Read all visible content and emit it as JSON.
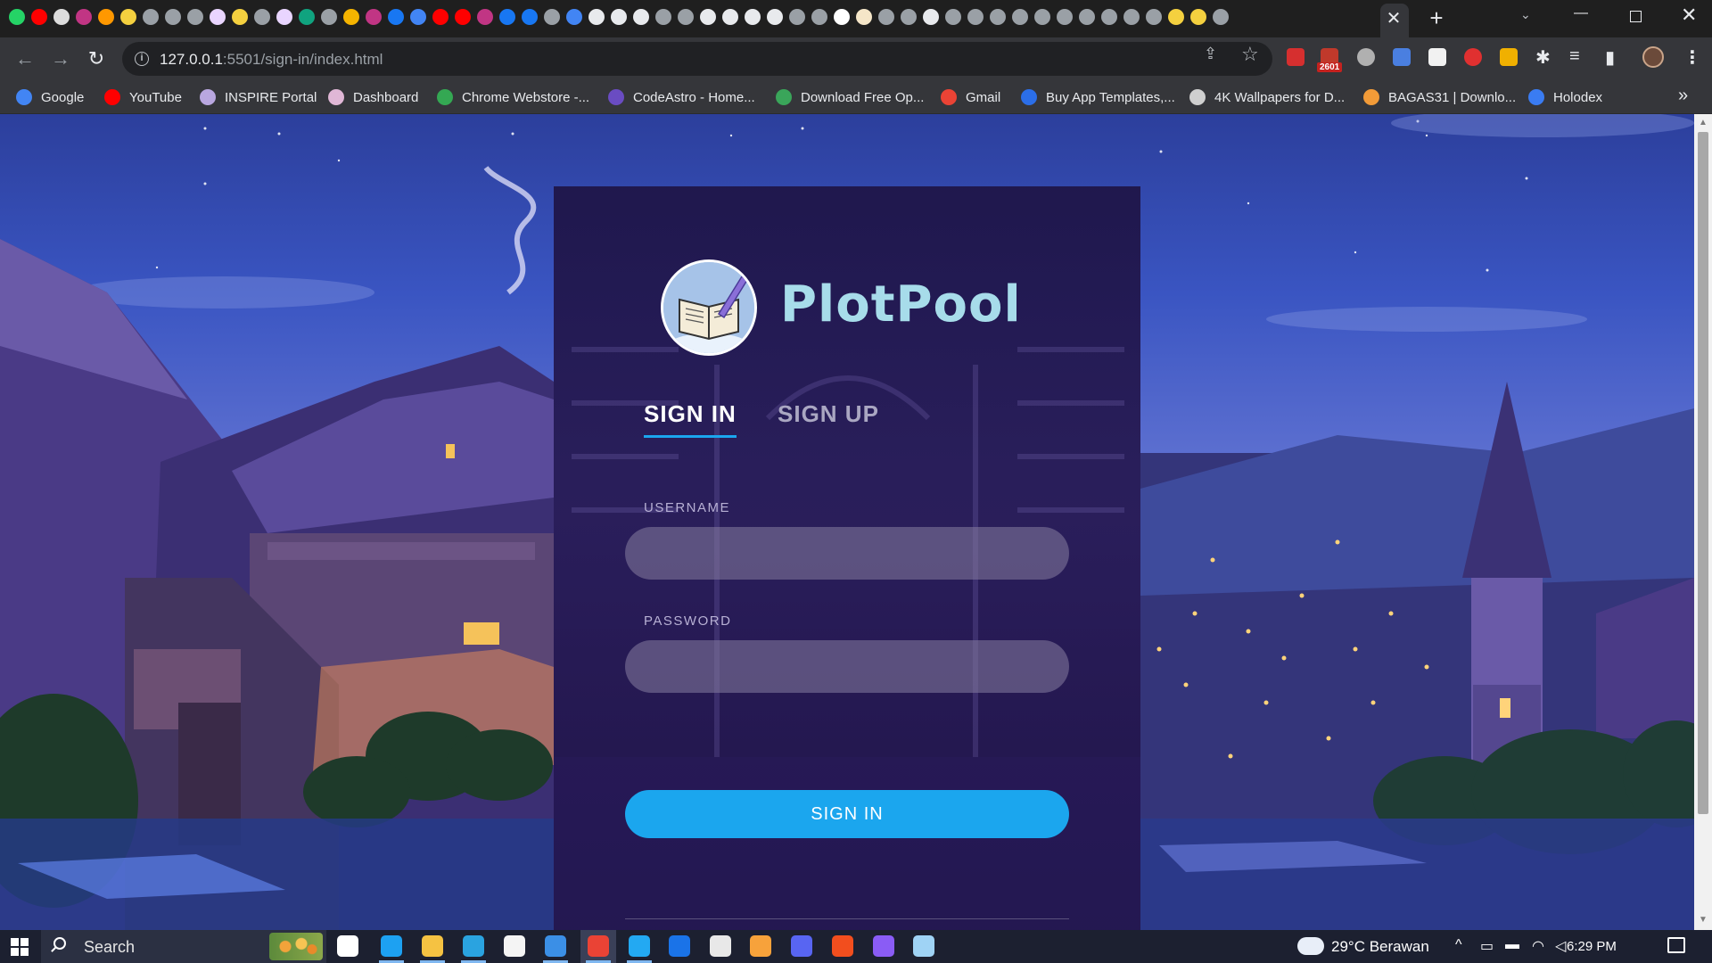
{
  "browser": {
    "tab_icon_colors": [
      "#25d366",
      "#ff0000",
      "#dddddd",
      "#c13584",
      "#ff9800",
      "#f4d03f",
      "#9aa0a6",
      "#9aa0a6",
      "#9aa0a6",
      "#e9d5ff",
      "#f4d03f",
      "#9aa0a6",
      "#e9d5ff",
      "#10a37f",
      "#9aa0a6",
      "#f5b400",
      "#c13584",
      "#1877f2",
      "#4285f4",
      "#ff0000",
      "#ff0000",
      "#c13584",
      "#1877f2",
      "#1877f2",
      "#9aa0a6",
      "#4285f4",
      "#e8eaed",
      "#e8eaed",
      "#e8eaed",
      "#9aa0a6",
      "#9aa0a6",
      "#e8eaed",
      "#e8eaed",
      "#e8eaed",
      "#e8eaed",
      "#9aa0a6",
      "#9aa0a6",
      "#ffffff",
      "#f5e6c8",
      "#9aa0a6",
      "#9aa0a6",
      "#e8eaed",
      "#9aa0a6",
      "#9aa0a6",
      "#9aa0a6",
      "#9aa0a6",
      "#9aa0a6",
      "#9aa0a6",
      "#9aa0a6",
      "#9aa0a6",
      "#9aa0a6",
      "#9aa0a6",
      "#f4d03f",
      "#f4d03f",
      "#9aa0a6"
    ],
    "active_tab_close": "✕",
    "new_tab_label": "+",
    "tab_search_icon": "⌄",
    "window_min": "—",
    "window_close": "✕",
    "back": "←",
    "forward": "→",
    "reload": "↻",
    "site_info_icon": "i",
    "url_host": "127.0.0.1",
    "url_rest": ":5501/sign-in/index.html",
    "share_icon": "⇪",
    "star_icon": "☆",
    "ext_badge": "2601",
    "extensions_icon": "✱",
    "reading_list_icon": "≡",
    "sidebar_icon": "▮",
    "menu_icon": "⋮",
    "bookmarks": [
      {
        "label": "Google",
        "color": "#4285f4"
      },
      {
        "label": "YouTube",
        "color": "#ff0000"
      },
      {
        "label": "INSPIRE Portal",
        "color": "#b9a7e0"
      },
      {
        "label": "Dashboard",
        "color": "#e0b7d6"
      },
      {
        "label": "Chrome Webstore -...",
        "color": "#34a853"
      },
      {
        "label": "CodeAstro - Home...",
        "color": "#6a4cc2"
      },
      {
        "label": "Download Free Op...",
        "color": "#3aa55a"
      },
      {
        "label": "Gmail",
        "color": "#ea4335"
      },
      {
        "label": "Buy App Templates,...",
        "color": "#2b6ee8"
      },
      {
        "label": "4K Wallpapers for D...",
        "color": "#cfcfcf"
      },
      {
        "label": "BAGAS31 | Downlo...",
        "color": "#f29b38"
      },
      {
        "label": "Holodex",
        "color": "#3a7cf2"
      }
    ],
    "bookmarks_more": "»"
  },
  "page": {
    "brand": "PlotPool",
    "tabs": {
      "sign_in": "SIGN IN",
      "sign_up": "SIGN UP"
    },
    "username_label": "USERNAME",
    "username_value": "",
    "password_label": "PASSWORD",
    "password_value": "",
    "submit_label": "SIGN IN",
    "accent": "#1ba6ee",
    "brand_color": "#a7dcea"
  },
  "taskbar": {
    "search_label": "Search",
    "weather": "29°C  Berawan",
    "time": "6:29 PM",
    "tray_chevron": "^",
    "app_colors": [
      "#ffffff",
      "#1da1f2",
      "#f5c242",
      "#2aa3e0",
      "#f4f4f4",
      "#3b8fe6",
      "#ea4335",
      "#23a9f2",
      "#1a73e8",
      "#e8e8e8",
      "#f7a23b",
      "#5865f2",
      "#f24e1e",
      "#8a5cf5",
      "#9fd3f5"
    ]
  }
}
